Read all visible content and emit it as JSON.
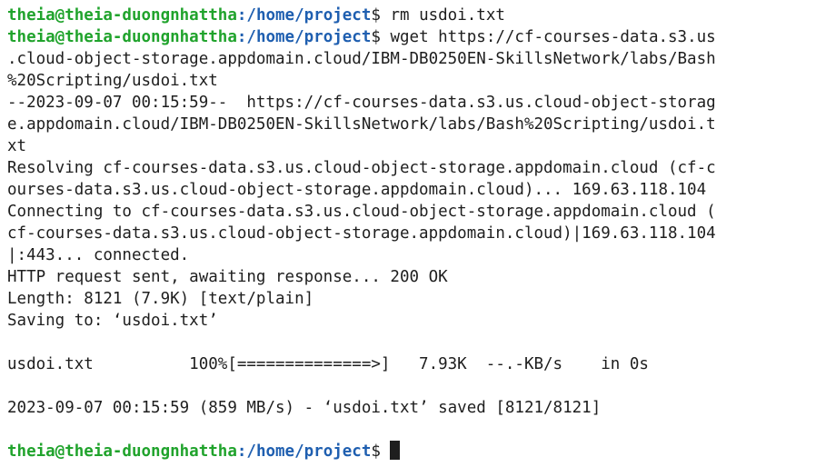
{
  "prompt": {
    "user_host": "theia@theia-duongnhattha",
    "path": ":/home/project",
    "symbol": "$ "
  },
  "commands": {
    "rm": "rm usdoi.txt",
    "wget_1": "wget https://cf-courses-data.s3.us",
    "wget_2": ".cloud-object-storage.appdomain.cloud/IBM-DB0250EN-SkillsNetwork/labs/Bash",
    "wget_3": "%20Scripting/usdoi.txt"
  },
  "output": [
    "--2023-09-07 00:15:59--  https://cf-courses-data.s3.us.cloud-object-storag",
    "e.appdomain.cloud/IBM-DB0250EN-SkillsNetwork/labs/Bash%20Scripting/usdoi.t",
    "xt",
    "Resolving cf-courses-data.s3.us.cloud-object-storage.appdomain.cloud (cf-c",
    "ourses-data.s3.us.cloud-object-storage.appdomain.cloud)... 169.63.118.104",
    "Connecting to cf-courses-data.s3.us.cloud-object-storage.appdomain.cloud (",
    "cf-courses-data.s3.us.cloud-object-storage.appdomain.cloud)|169.63.118.104",
    "|:443... connected.",
    "HTTP request sent, awaiting response... 200 OK",
    "Length: 8121 (7.9K) [text/plain]",
    "Saving to: ‘usdoi.txt’",
    "",
    "usdoi.txt          100%[==============>]   7.93K  --.-KB/s    in 0s",
    "",
    "2023-09-07 00:15:59 (859 MB/s) - ‘usdoi.txt’ saved [8121/8121]",
    ""
  ],
  "colors": {
    "prompt_user": "#20a32c",
    "prompt_path": "#1f5fb0",
    "text": "#1e1e1e",
    "background": "#ffffff"
  }
}
